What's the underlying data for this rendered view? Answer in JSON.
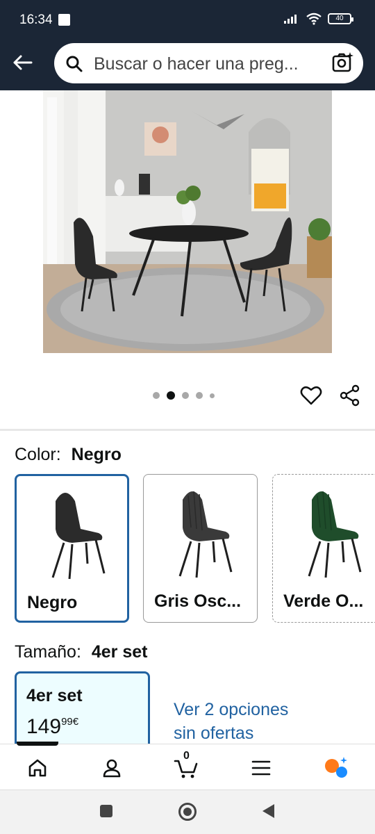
{
  "status_bar": {
    "time": "16:34",
    "battery": "40"
  },
  "header": {
    "search": {
      "placeholder": "Buscar o hacer una preg..."
    }
  },
  "gallery": {
    "dots_count": 5,
    "active_index": 1
  },
  "color": {
    "label": "Color:",
    "selected_value": "Negro",
    "options": [
      {
        "label": "Negro",
        "swatch_color": "#2b2b2b"
      },
      {
        "label": "Gris Osc...",
        "swatch_color": "#3a3a3a"
      },
      {
        "label": "Verde O...",
        "swatch_color": "#1f4d2b"
      }
    ]
  },
  "size": {
    "label": "Tamaño:",
    "selected_value": "4er set",
    "option_label": "4er set",
    "price_whole": "149",
    "price_fraction": "99",
    "price_currency": "€",
    "other_options_line1": "Ver 2 opciones",
    "other_options_line2": "sin ofertas"
  },
  "bottom_nav": {
    "items": [
      "home-icon",
      "account-icon",
      "cart-icon",
      "menu-icon",
      "rufus-icon"
    ],
    "cart_count": "0"
  },
  "colors": {
    "header_bg": "#1b2636",
    "link_blue": "#2162a1",
    "selected_bg": "#edfdff"
  }
}
